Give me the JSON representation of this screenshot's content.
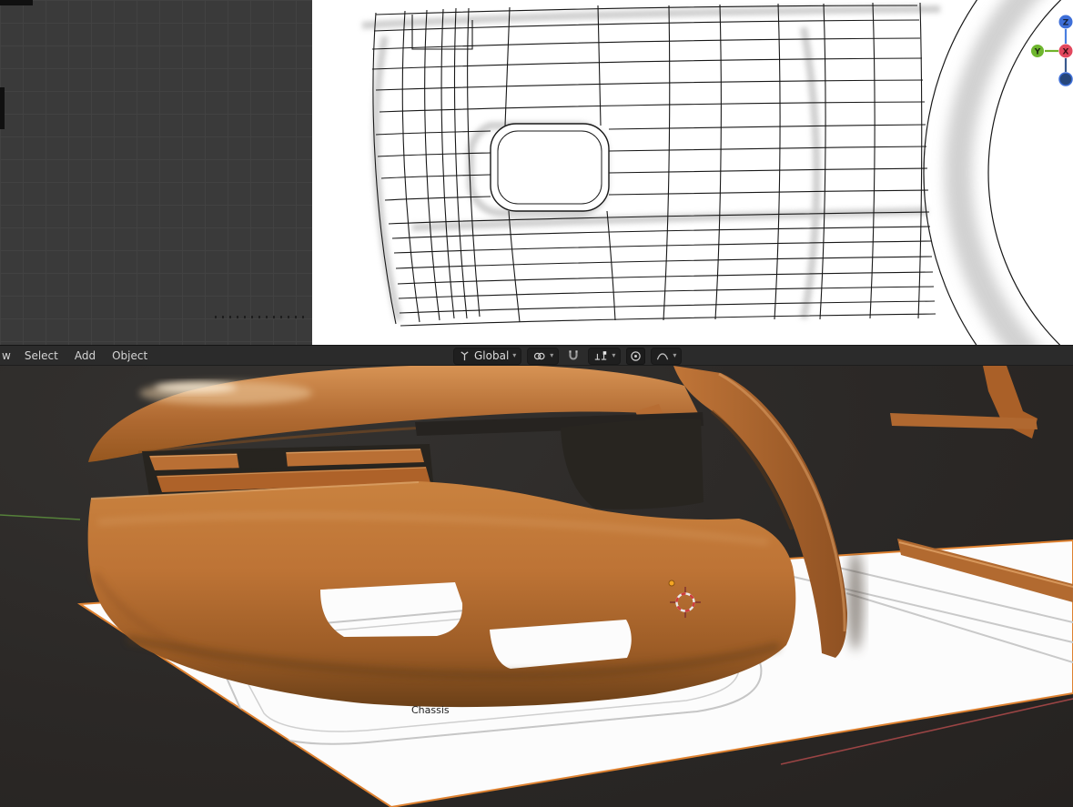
{
  "menu_bar": {
    "items": [
      {
        "label": "w"
      },
      {
        "label": "Select"
      },
      {
        "label": "Add"
      },
      {
        "label": "Object"
      }
    ],
    "transform_orientation": {
      "label": "Global"
    },
    "chevron": "▾"
  },
  "gizmo": {
    "axes": {
      "x": "X",
      "y": "Y",
      "z": "Z"
    }
  },
  "scene": {
    "active_object_label": "Chassis"
  },
  "colors": {
    "car_body": "#bf7338",
    "car_shadow": "#6f431a",
    "car_highlight": "#e8c39a",
    "selection_outline": "#de8130",
    "axis_x": "#e2485e",
    "axis_y": "#6eb62e",
    "axis_z": "#3e6fd8",
    "header_bg": "#2b2b2b",
    "viewport_bg_top": "#3b3b3b",
    "viewport_bg_bottom": "#2b2826",
    "reference_bg": "#ffffff"
  }
}
